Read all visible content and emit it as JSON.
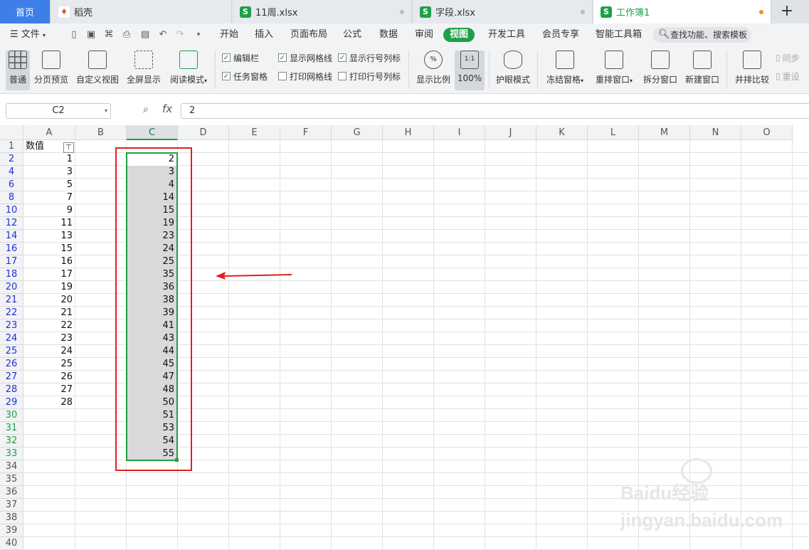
{
  "tabs": [
    {
      "label": "首页"
    },
    {
      "label": "稻壳",
      "icon": "daoke-logo-icon"
    },
    {
      "label": "11周.xlsx",
      "icon": "sheet-icon"
    },
    {
      "label": "字段.xlsx",
      "icon": "sheet-icon"
    },
    {
      "label": "工作簿1",
      "icon": "sheet-icon"
    }
  ],
  "new_tab": "+",
  "file_menu": "文件",
  "menus": [
    "开始",
    "插入",
    "页面布局",
    "公式",
    "数据",
    "审阅",
    "视图",
    "开发工具",
    "会员专享",
    "智能工具箱"
  ],
  "search_placeholder": "查找功能、搜索模板",
  "ribbon": {
    "big": [
      "普通",
      "分页预览",
      "自定义视图",
      "全屏显示",
      "阅读模式"
    ],
    "checks": [
      {
        "label": "编辑栏",
        "checked": true
      },
      {
        "label": "显示网格线",
        "checked": true
      },
      {
        "label": "显示行号列标",
        "checked": true
      },
      {
        "label": "任务窗格",
        "checked": true
      },
      {
        "label": "打印网格线",
        "checked": false
      },
      {
        "label": "打印行号列标",
        "checked": false
      }
    ],
    "zoom": [
      "显示比例",
      "100%"
    ],
    "zoom_icon_text": "1:1",
    "right": [
      "护眼模式",
      "冻结窗格",
      "重排窗口",
      "拆分窗口",
      "新建窗口",
      "并排比较"
    ],
    "partial": [
      "同步",
      "重设"
    ]
  },
  "formula_bar": {
    "name_box": "C2",
    "fx": "fx",
    "value": "2"
  },
  "columns": [
    "A",
    "B",
    "C",
    "D",
    "E",
    "F",
    "G",
    "H",
    "I",
    "J",
    "K",
    "L",
    "M",
    "N",
    "O"
  ],
  "selected_column": "C",
  "rows": [
    {
      "n": "1",
      "a": "数值",
      "c": ""
    },
    {
      "n": "2",
      "a": "1",
      "c": "2"
    },
    {
      "n": "4",
      "a": "3",
      "c": "3"
    },
    {
      "n": "6",
      "a": "5",
      "c": "4"
    },
    {
      "n": "8",
      "a": "7",
      "c": "14"
    },
    {
      "n": "10",
      "a": "9",
      "c": "15"
    },
    {
      "n": "12",
      "a": "11",
      "c": "19"
    },
    {
      "n": "14",
      "a": "13",
      "c": "23"
    },
    {
      "n": "16",
      "a": "15",
      "c": "24"
    },
    {
      "n": "17",
      "a": "16",
      "c": "25"
    },
    {
      "n": "18",
      "a": "17",
      "c": "35"
    },
    {
      "n": "20",
      "a": "19",
      "c": "36"
    },
    {
      "n": "21",
      "a": "20",
      "c": "38"
    },
    {
      "n": "22",
      "a": "21",
      "c": "39"
    },
    {
      "n": "23",
      "a": "22",
      "c": "41"
    },
    {
      "n": "24",
      "a": "23",
      "c": "43"
    },
    {
      "n": "25",
      "a": "24",
      "c": "44"
    },
    {
      "n": "26",
      "a": "25",
      "c": "45"
    },
    {
      "n": "27",
      "a": "26",
      "c": "47"
    },
    {
      "n": "28",
      "a": "27",
      "c": "48"
    },
    {
      "n": "29",
      "a": "28",
      "c": "50"
    },
    {
      "n": "30",
      "a": "",
      "c": "51"
    },
    {
      "n": "31",
      "a": "",
      "c": "53"
    },
    {
      "n": "32",
      "a": "",
      "c": "54"
    },
    {
      "n": "33",
      "a": "",
      "c": "55"
    },
    {
      "n": "34",
      "a": "",
      "c": ""
    },
    {
      "n": "35",
      "a": "",
      "c": ""
    },
    {
      "n": "36",
      "a": "",
      "c": ""
    },
    {
      "n": "37",
      "a": "",
      "c": ""
    },
    {
      "n": "38",
      "a": "",
      "c": ""
    },
    {
      "n": "39",
      "a": "",
      "c": ""
    },
    {
      "n": "40",
      "a": "",
      "c": ""
    }
  ],
  "colors": {
    "accent": "#1fa047",
    "annotation": "#e02020",
    "filtered_row_number": "#1f2fd6"
  },
  "watermark": "Baidu经验 jingyan.baidu.com"
}
